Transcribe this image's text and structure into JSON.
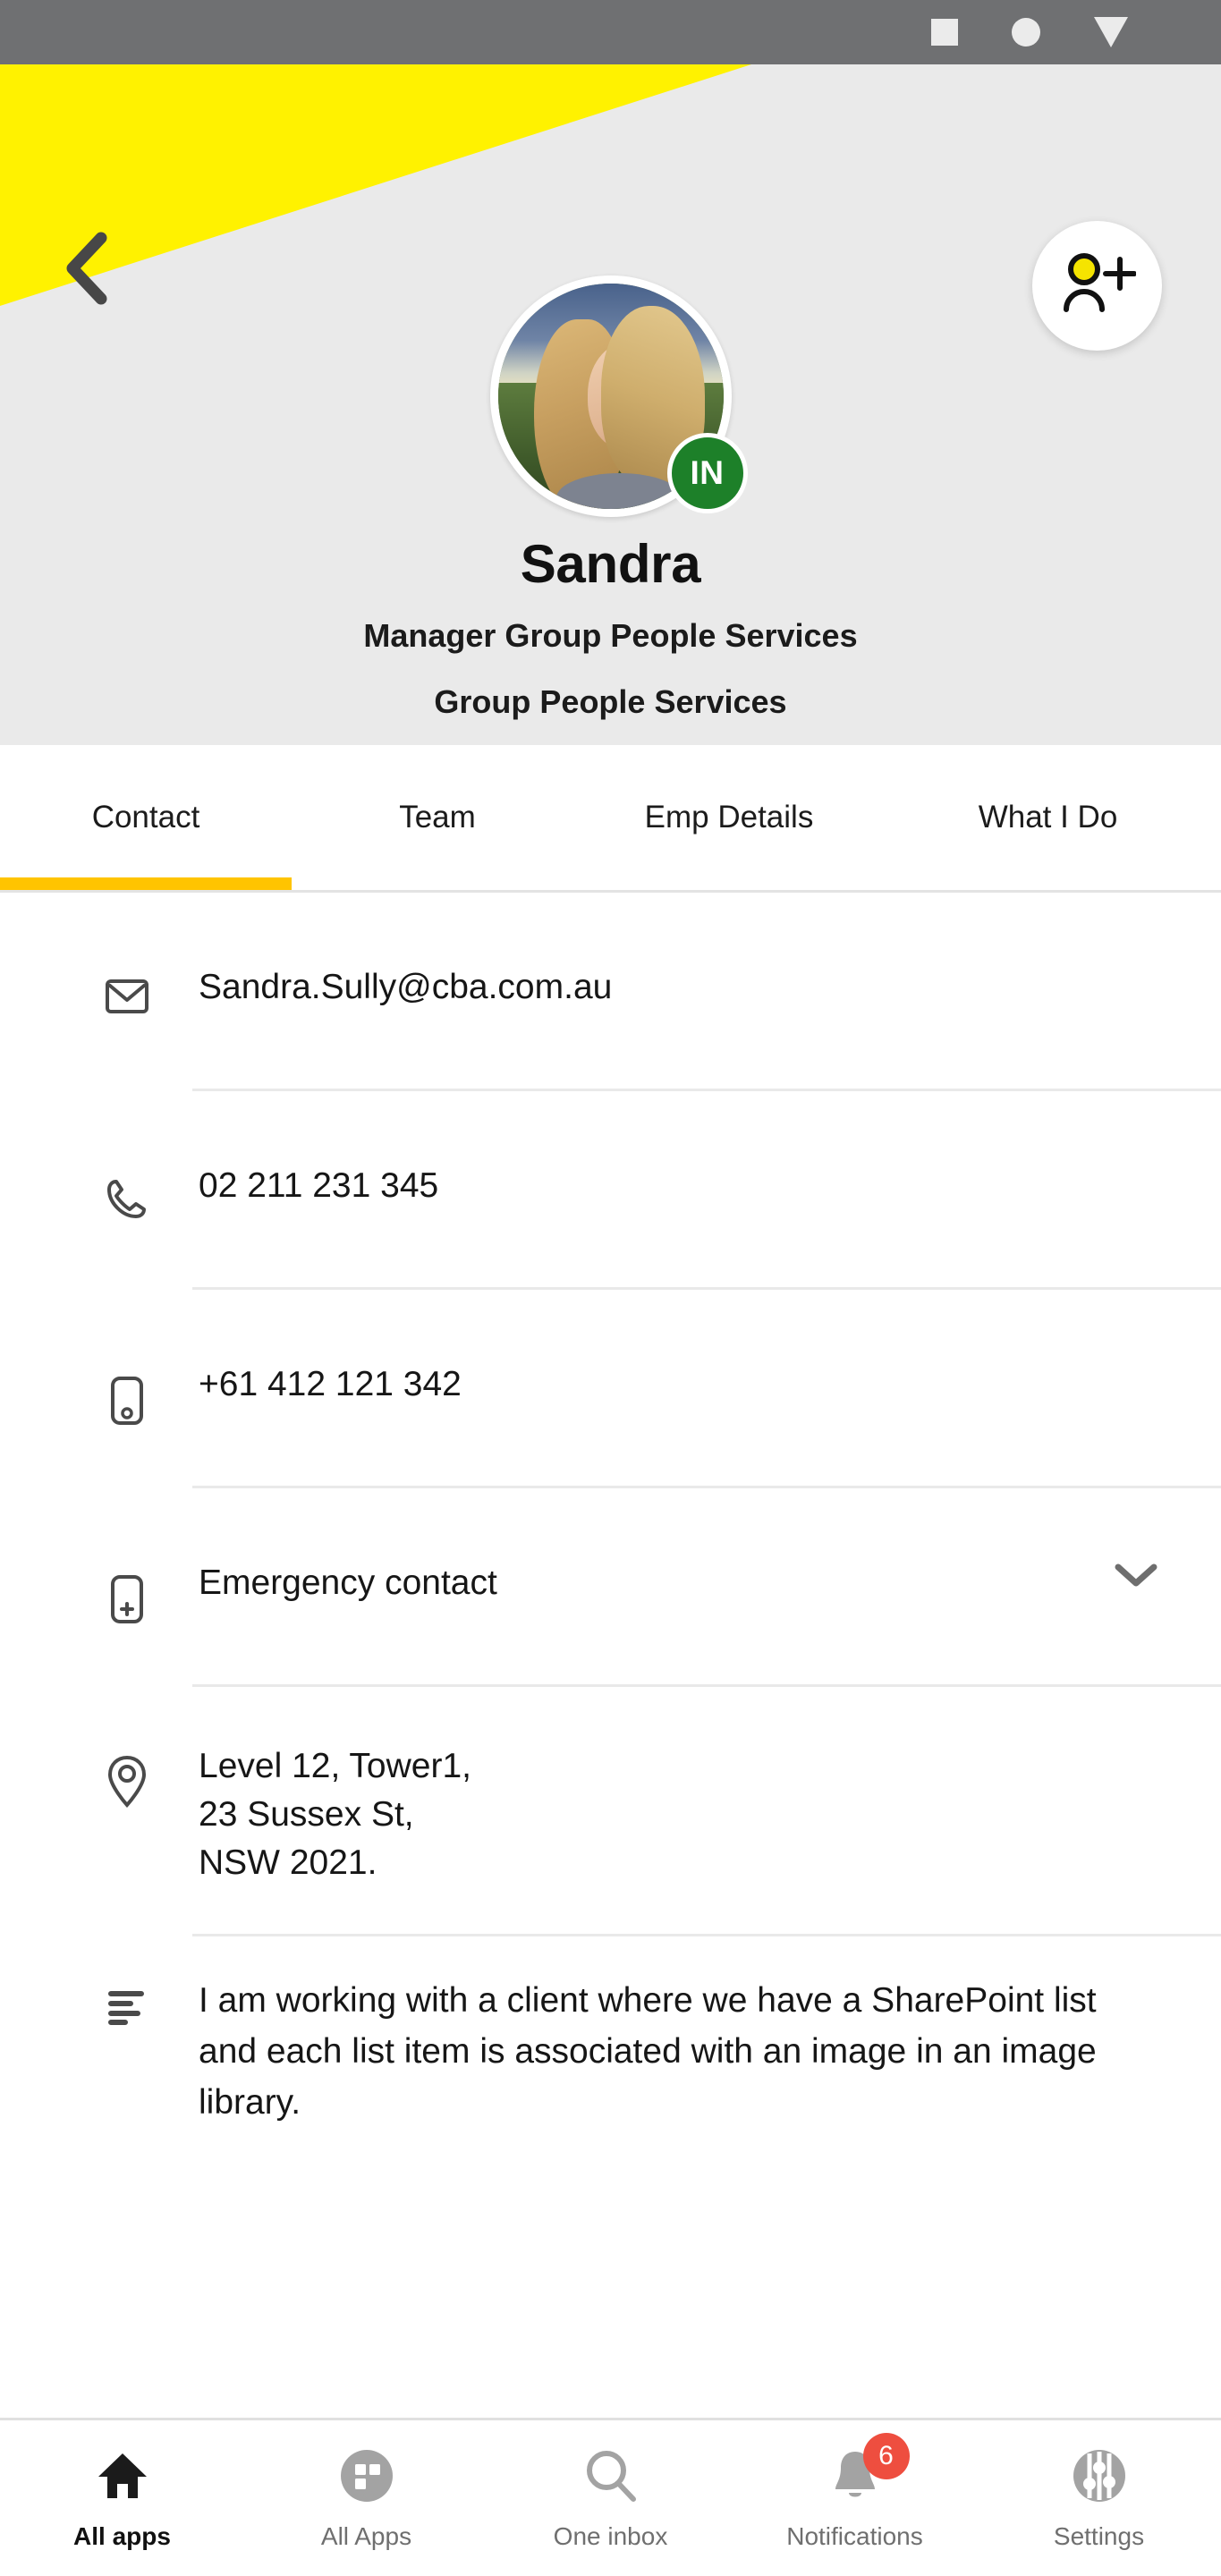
{
  "statusbar": {
    "icons": [
      "square-icon",
      "circle-icon",
      "triangle-icon"
    ]
  },
  "header": {
    "back_icon": "chevron-left-icon",
    "add_person_icon": "add-person-icon",
    "avatar_alt": "Sandra profile photo",
    "status_badge": "IN",
    "name": "Sandra",
    "title": "Manager Group People Services",
    "department": "Group People Services",
    "accent_yellow": "#FFF200",
    "header_bg": "#EAEAEA",
    "badge_green": "#1D8029"
  },
  "tabs": {
    "active_index": 0,
    "underline_color": "#FFC400",
    "items": [
      {
        "label": "Contact"
      },
      {
        "label": "Team"
      },
      {
        "label": "Emp Details"
      },
      {
        "label": "What I Do"
      }
    ]
  },
  "contact": {
    "rows": [
      {
        "icon": "email-icon",
        "value": "Sandra.Sully@cba.com.au"
      },
      {
        "icon": "phone-icon",
        "value": "02 211 231 345"
      },
      {
        "icon": "mobile-icon",
        "value": "+61 412 121 342"
      },
      {
        "icon": "emergency-contact-icon",
        "value": "Emergency contact",
        "expander": "chevron-down-icon"
      }
    ],
    "address": {
      "icon": "location-pin-icon",
      "lines": [
        "Level 12, Tower1,",
        "23 Sussex St,",
        "NSW 2021."
      ]
    },
    "note": {
      "icon": "notes-icon",
      "text": "I am working with a client where we have a SharePoint list and each list item is associated with an image in an image library."
    }
  },
  "bottom_nav": {
    "active_index": 0,
    "badge_color": "#EE4E3F",
    "items": [
      {
        "label": "All apps",
        "icon": "home-icon"
      },
      {
        "label": "All Apps",
        "icon": "grid-apps-icon"
      },
      {
        "label": "One inbox",
        "icon": "search-icon"
      },
      {
        "label": "Notifications",
        "icon": "bell-icon",
        "badge": "6"
      },
      {
        "label": "Settings",
        "icon": "settings-sliders-icon"
      }
    ]
  }
}
